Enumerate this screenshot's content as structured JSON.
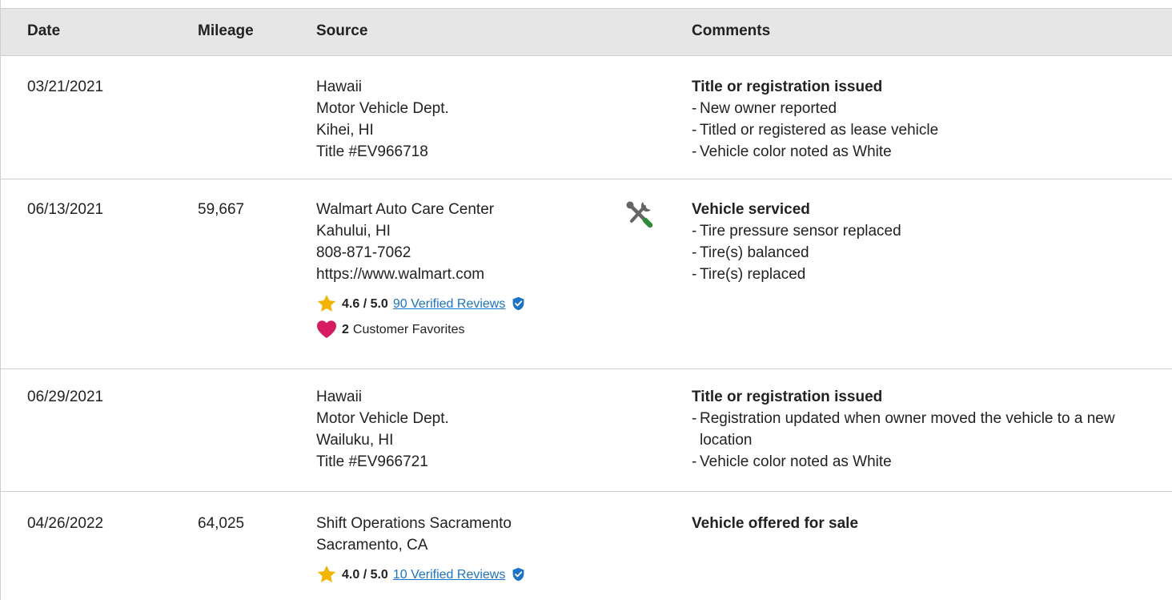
{
  "header": {
    "date": "Date",
    "mileage": "Mileage",
    "source": "Source",
    "comments": "Comments"
  },
  "rows": [
    {
      "date": "03/21/2021",
      "mileage": "",
      "source": [
        "Hawaii",
        "Motor Vehicle Dept.",
        "Kihei, HI",
        "Title #EV966718"
      ],
      "comment_title": "Title or registration issued",
      "comment_items": [
        "New owner reported",
        "Titled or registered as lease vehicle",
        "Vehicle color noted as White"
      ]
    },
    {
      "date": "06/13/2021",
      "mileage": "59,667",
      "source": [
        "Walmart Auto Care Center",
        "Kahului, HI",
        "808-871-7062",
        "https://www.walmart.com"
      ],
      "icon": "service-tools-icon",
      "rating": {
        "score": "4.6 / 5.0",
        "reviews_link": "90 Verified Reviews"
      },
      "favorites": {
        "count": "2",
        "label": "Customer Favorites"
      },
      "comment_title": "Vehicle serviced",
      "comment_items": [
        "Tire pressure sensor replaced",
        "Tire(s) balanced",
        "Tire(s) replaced"
      ]
    },
    {
      "date": "06/29/2021",
      "mileage": "",
      "source": [
        "Hawaii",
        "Motor Vehicle Dept.",
        "Wailuku, HI",
        "Title #EV966721"
      ],
      "comment_title": "Title or registration issued",
      "comment_items": [
        "Registration updated when owner moved the vehicle to a new location",
        "Vehicle color noted as White"
      ]
    },
    {
      "date": "04/26/2022",
      "mileage": "64,025",
      "source": [
        "Shift Operations Sacramento",
        "Sacramento, CA"
      ],
      "rating": {
        "score": "4.0 / 5.0",
        "reviews_link": "10 Verified Reviews"
      },
      "comment_title": "Vehicle offered for sale",
      "comment_items": []
    }
  ],
  "colors": {
    "header_bg": "#e6e6e6",
    "link": "#1a73c8",
    "star": "#f5b400",
    "heart": "#d81b60",
    "shield": "#1a73c8",
    "tools_green": "#2e8b3a",
    "tools_gray": "#666666"
  }
}
